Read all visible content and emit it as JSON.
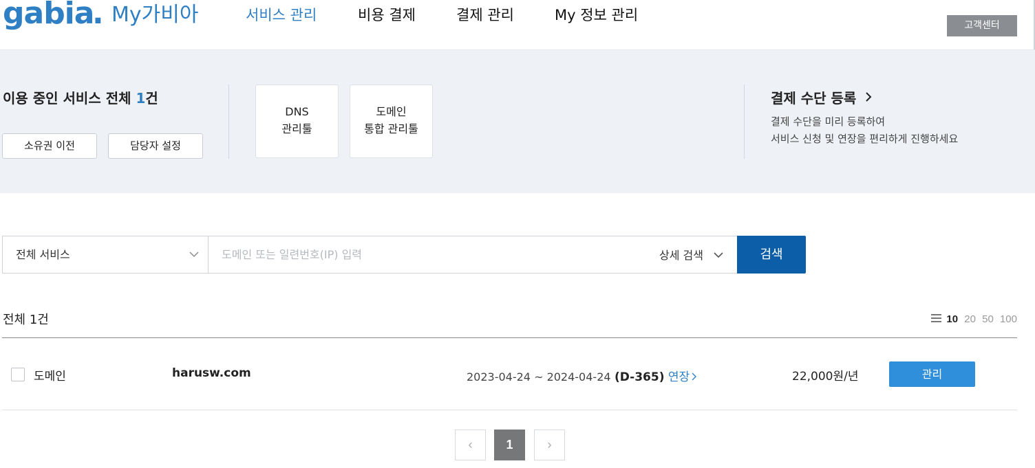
{
  "header": {
    "logo_text": "gabia",
    "logo_dot": ".",
    "app_title": "My가비아",
    "nav": [
      {
        "label": "서비스 관리",
        "active": true
      },
      {
        "label": "비용 결제",
        "active": false
      },
      {
        "label": "결제 관리",
        "active": false
      },
      {
        "label": "My 정보 관리",
        "active": false
      }
    ],
    "customer_center": "고객센터"
  },
  "summary": {
    "title_prefix": "이용 중인 서비스 전체",
    "count": "1",
    "title_suffix": "건",
    "buttons": {
      "transfer": "소유권 이전",
      "contact": "담당자 설정"
    },
    "tools": [
      {
        "line1": "DNS",
        "line2": "관리툴"
      },
      {
        "line1": "도메인",
        "line2": "통합 관리툴"
      }
    ],
    "payment": {
      "title": "결제 수단 등록",
      "desc_line1": "결제 수단을 미리 등록하여",
      "desc_line2": "서비스 신청 및 연장을 편리하게 진행하세요"
    }
  },
  "search": {
    "service_select": "전체 서비스",
    "placeholder": "도메인 또는 일련번호(IP) 입력",
    "detail": "상세 검색",
    "button": "검색"
  },
  "list": {
    "total_label": "전체 1건",
    "page_sizes": [
      "10",
      "20",
      "50",
      "100"
    ],
    "selected_page_size": "10",
    "rows": [
      {
        "type": "도메인",
        "name": "harusw.com",
        "period": "2023-04-24 ~ 2024-04-24",
        "dday": "(D-365)",
        "extend": "연장",
        "price": "22,000원/년",
        "action": "관리"
      }
    ]
  },
  "pagination": {
    "current": "1",
    "prev": "‹",
    "next": "›"
  },
  "colors": {
    "brand": "#2f7fc4",
    "search_button": "#0d5ea8",
    "manage_button": "#2f8fdb",
    "band_bg": "#eef1f5"
  }
}
